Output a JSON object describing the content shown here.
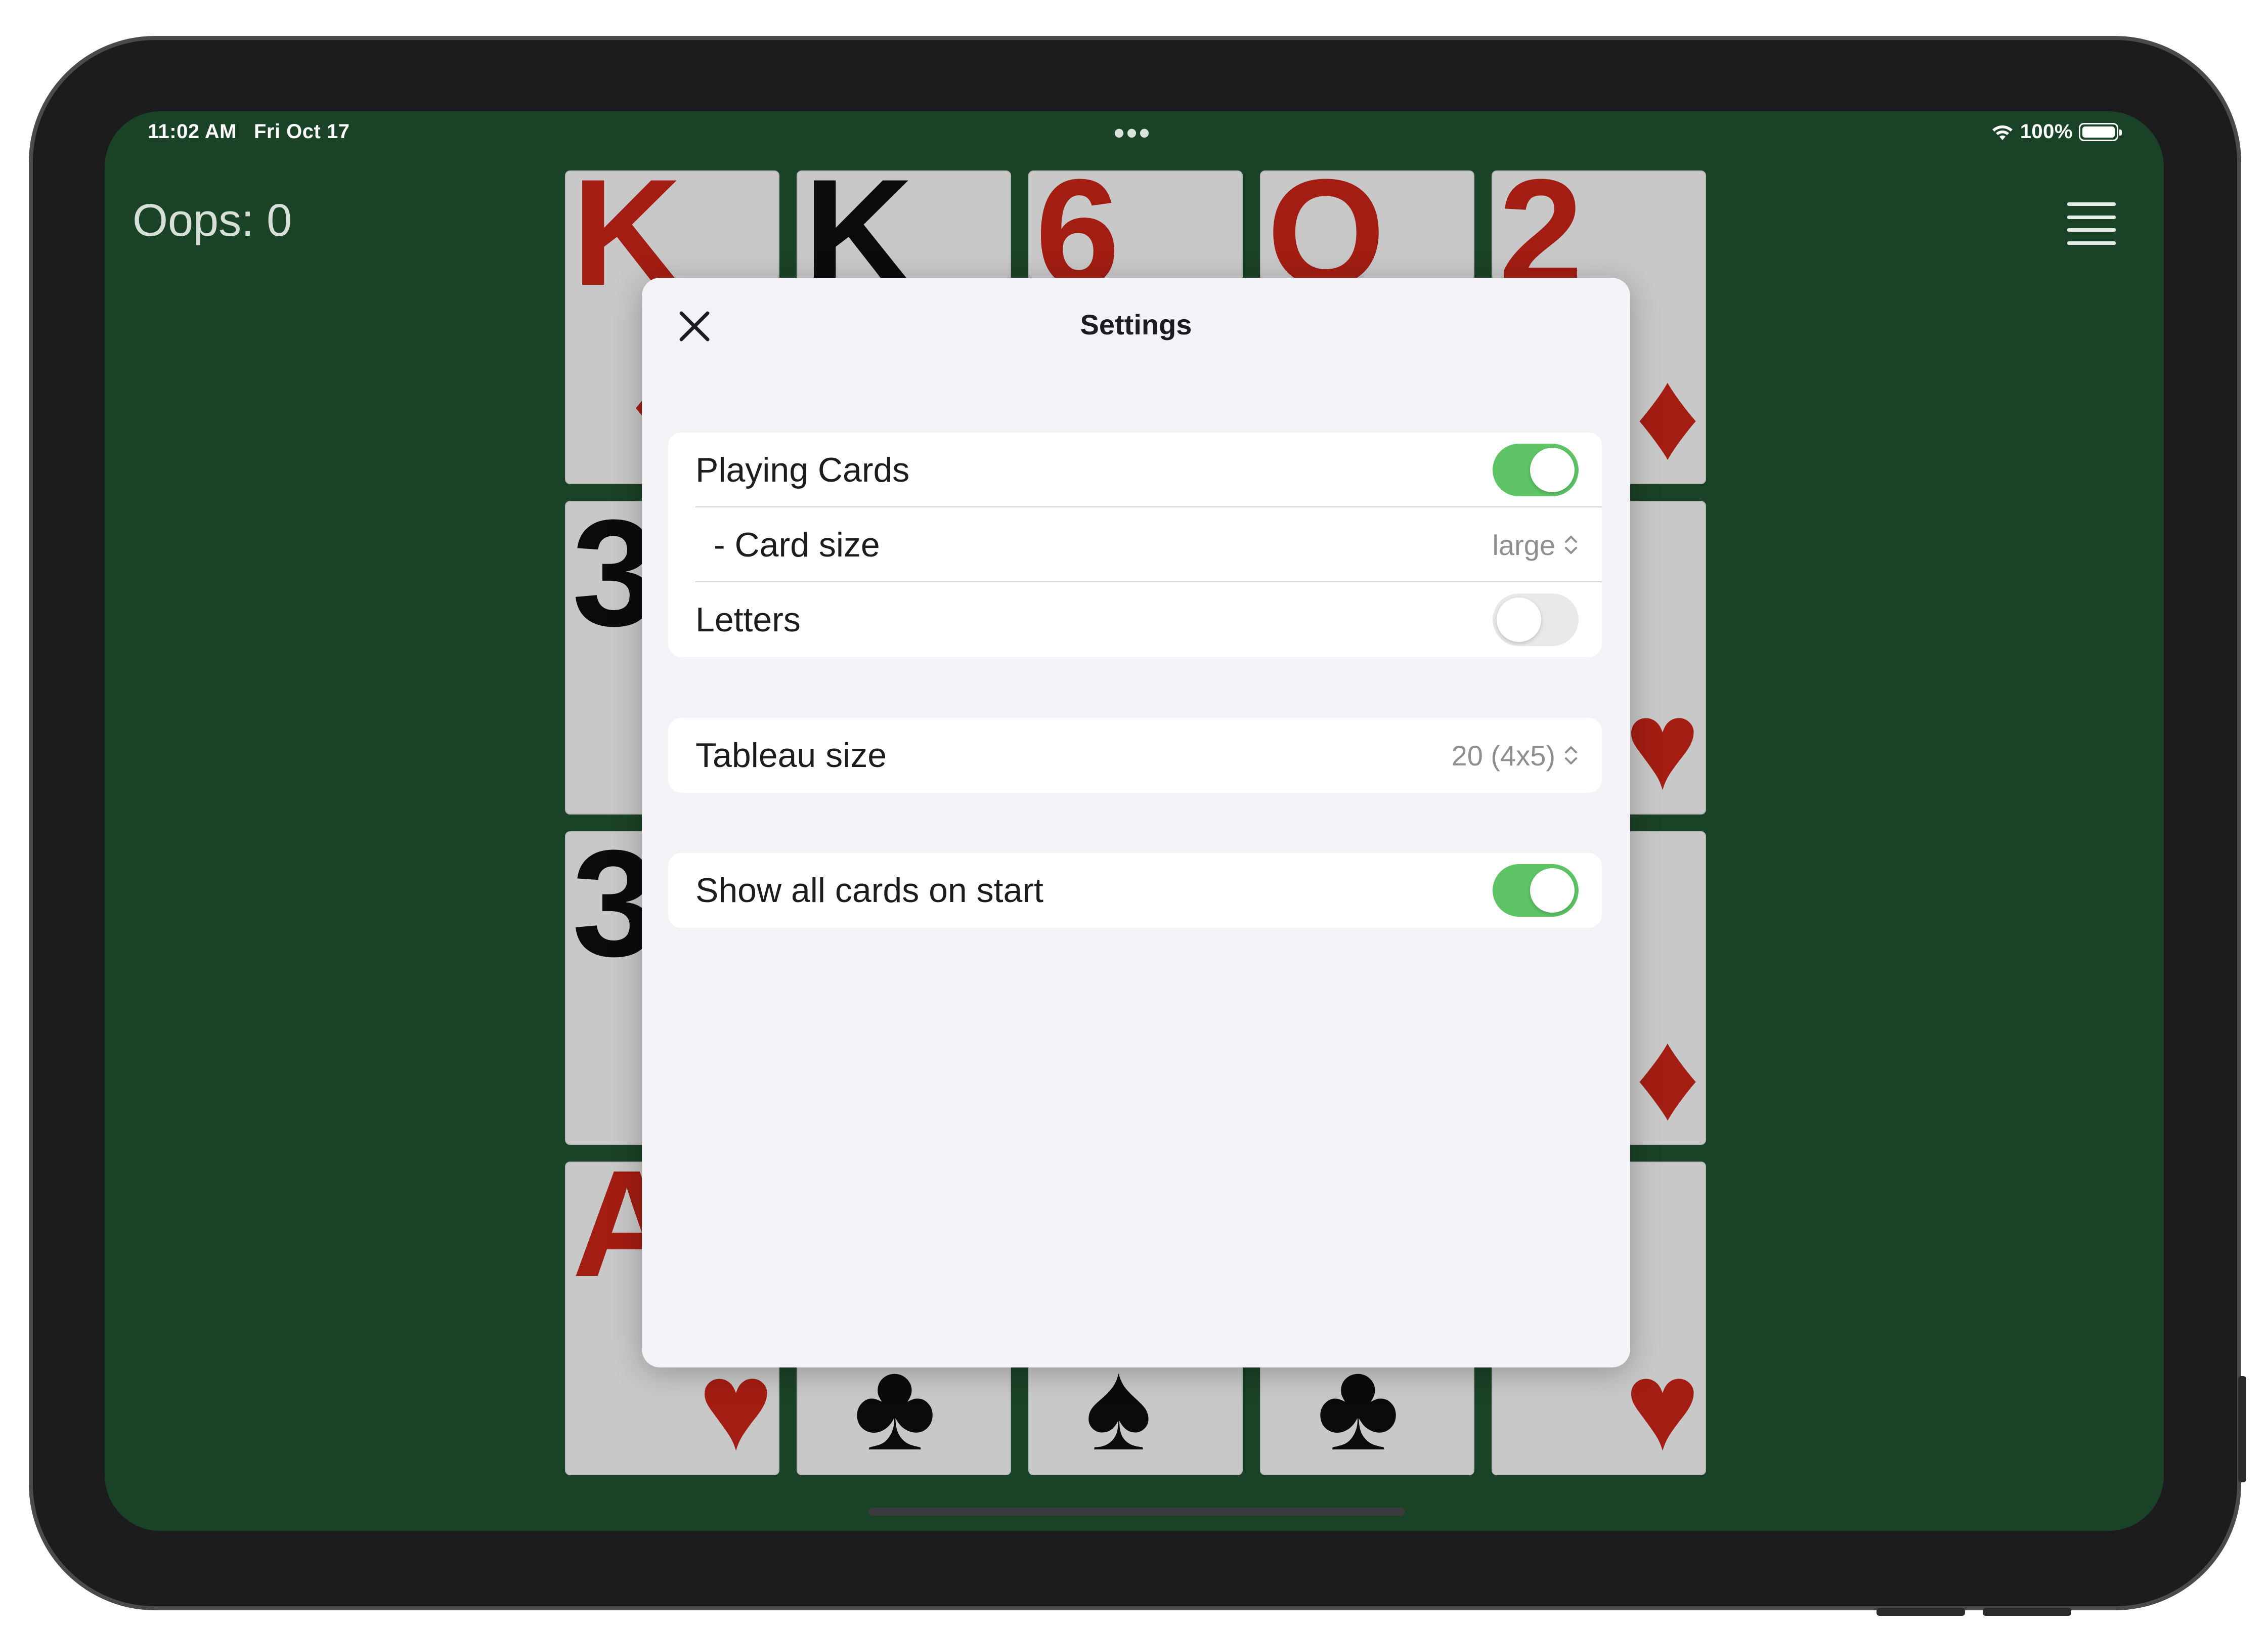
{
  "status_bar": {
    "time": "11:02 AM",
    "date": "Fri Oct 17",
    "battery": "100%",
    "wifi_icon": "wifi-icon",
    "battery_icon": "battery-icon"
  },
  "game": {
    "oops_label": "Oops: 0",
    "menu_icon": "hamburger-menu-icon",
    "cards_visible": [
      {
        "rank": "K",
        "suit": "♦",
        "color": "#a31d12"
      },
      {
        "rank": "K",
        "suit": "",
        "color": "#0b0b0b"
      },
      {
        "rank": "6",
        "suit": "",
        "color": "#a31d12"
      },
      {
        "rank": "Q",
        "suit": "",
        "color": "#a31d12"
      },
      {
        "rank": "2",
        "suit": "♦",
        "color": "#a31d12"
      },
      {
        "rank": "3",
        "suit": "",
        "color": "#0b0b0b"
      },
      {
        "rank": "",
        "suit": "♥",
        "color": "#a31d12"
      },
      {
        "rank": "3",
        "suit": "",
        "color": "#0b0b0b"
      },
      {
        "rank": "",
        "suit": "♦",
        "color": "#a31d12"
      },
      {
        "rank": "A",
        "suit": "♥",
        "color": "#a31d12"
      },
      {
        "rank": "",
        "suit": "♣",
        "color": "#0b0b0b"
      },
      {
        "rank": "",
        "suit": "♠",
        "color": "#0b0b0b"
      },
      {
        "rank": "",
        "suit": "♣",
        "color": "#0b0b0b"
      },
      {
        "rank": "",
        "suit": "♥",
        "color": "#a31d12"
      }
    ]
  },
  "settings": {
    "title": "Settings",
    "close_icon": "close-icon",
    "groups": [
      {
        "rows": [
          {
            "label": "Playing Cards",
            "control": "toggle",
            "on": true
          },
          {
            "label": "- Card size",
            "control": "select",
            "value": "large"
          },
          {
            "label": "Letters",
            "control": "toggle",
            "on": false
          }
        ]
      },
      {
        "rows": [
          {
            "label": "Tableau size",
            "control": "select",
            "value": "20 (4x5)"
          }
        ]
      },
      {
        "rows": [
          {
            "label": "Show all cards on start",
            "control": "toggle",
            "on": true
          }
        ]
      }
    ]
  },
  "colors": {
    "felt": "#1a4226",
    "toggle_on": "#5ec466",
    "toggle_off": "#e9e9eb",
    "card_red": "#a31d12"
  }
}
